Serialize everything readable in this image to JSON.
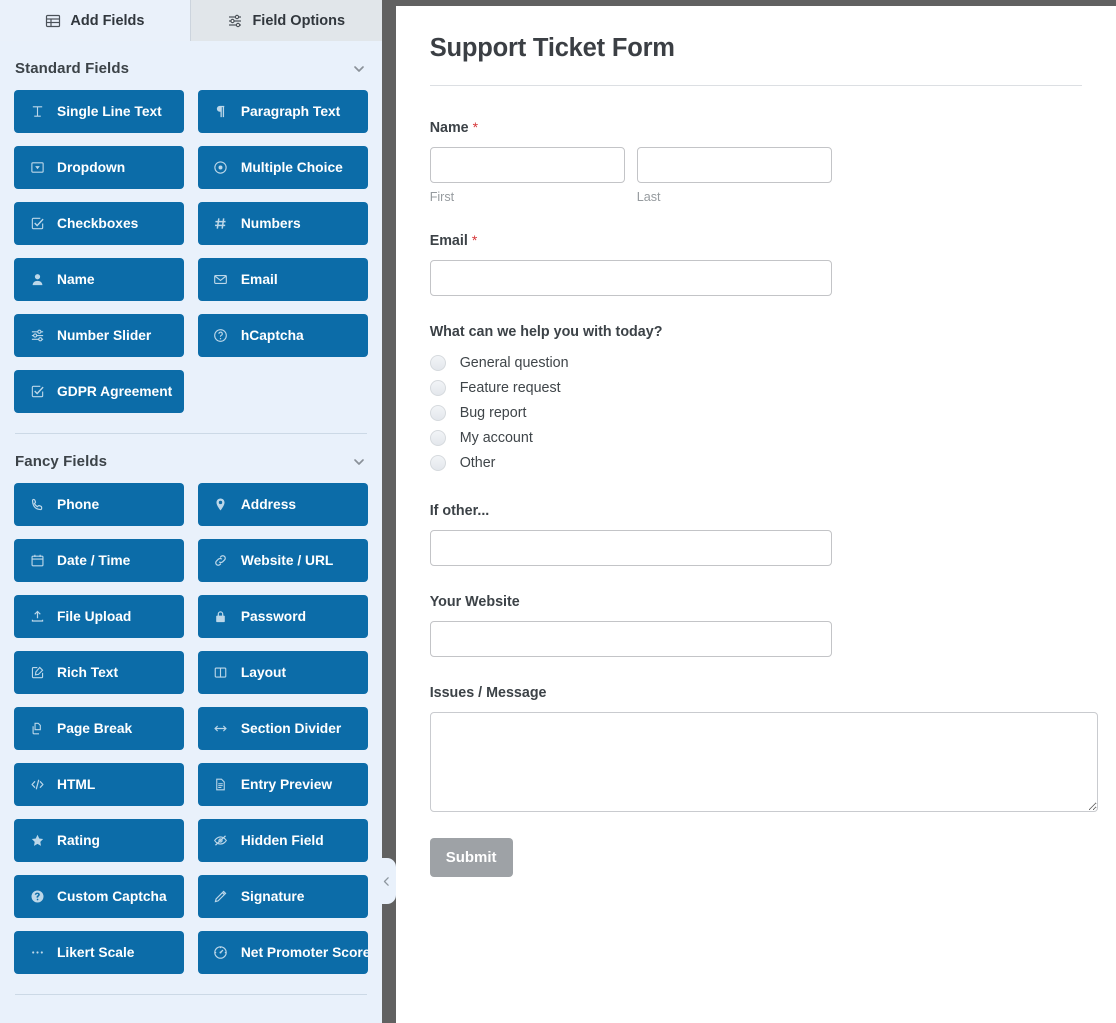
{
  "tabs": [
    {
      "label": "Add Fields",
      "icon": "table-icon",
      "active": true
    },
    {
      "label": "Field Options",
      "icon": "sliders-icon",
      "active": false
    }
  ],
  "sections": [
    {
      "title": "Standard Fields",
      "chevron": "chevron-down-icon",
      "fields": [
        {
          "label": "Single Line Text",
          "icon": "text-cursor-icon"
        },
        {
          "label": "Paragraph Text",
          "icon": "pilcrow-icon"
        },
        {
          "label": "Dropdown",
          "icon": "dropdown-icon"
        },
        {
          "label": "Multiple Choice",
          "icon": "radio-icon"
        },
        {
          "label": "Checkboxes",
          "icon": "checkbox-icon"
        },
        {
          "label": "Numbers",
          "icon": "hash-icon"
        },
        {
          "label": "Name",
          "icon": "user-icon"
        },
        {
          "label": "Email",
          "icon": "envelope-icon"
        },
        {
          "label": "Number Slider",
          "icon": "sliders-icon"
        },
        {
          "label": "hCaptcha",
          "icon": "question-circle-icon"
        },
        {
          "label": "GDPR Agreement",
          "icon": "checkbox-icon"
        }
      ]
    },
    {
      "title": "Fancy Fields",
      "chevron": "chevron-down-icon",
      "fields": [
        {
          "label": "Phone",
          "icon": "phone-icon"
        },
        {
          "label": "Address",
          "icon": "map-pin-icon"
        },
        {
          "label": "Date / Time",
          "icon": "calendar-icon"
        },
        {
          "label": "Website / URL",
          "icon": "link-icon"
        },
        {
          "label": "File Upload",
          "icon": "upload-icon"
        },
        {
          "label": "Password",
          "icon": "lock-icon"
        },
        {
          "label": "Rich Text",
          "icon": "pencil-square-icon"
        },
        {
          "label": "Layout",
          "icon": "columns-icon"
        },
        {
          "label": "Page Break",
          "icon": "pages-icon"
        },
        {
          "label": "Section Divider",
          "icon": "arrows-horizontal-icon"
        },
        {
          "label": "HTML",
          "icon": "code-icon"
        },
        {
          "label": "Entry Preview",
          "icon": "document-icon"
        },
        {
          "label": "Rating",
          "icon": "star-icon"
        },
        {
          "label": "Hidden Field",
          "icon": "eye-slash-icon"
        },
        {
          "label": "Custom Captcha",
          "icon": "question-circle-icon"
        },
        {
          "label": "Signature",
          "icon": "pen-icon"
        },
        {
          "label": "Likert Scale",
          "icon": "dots-icon"
        },
        {
          "label": "Net Promoter Score",
          "icon": "gauge-icon"
        }
      ]
    }
  ],
  "collapse_handle": {
    "icon": "chevron-left-icon"
  },
  "form": {
    "title": "Support Ticket Form",
    "name_field": {
      "label": "Name",
      "required_mark": "*",
      "first_sublabel": "First",
      "last_sublabel": "Last",
      "first_value": "",
      "last_value": ""
    },
    "email_field": {
      "label": "Email",
      "required_mark": "*",
      "value": ""
    },
    "choice_field": {
      "label": "What can we help you with today?",
      "options": [
        "General question",
        "Feature request",
        "Bug report",
        "My account",
        "Other"
      ]
    },
    "other_field": {
      "label": "If other...",
      "value": ""
    },
    "website_field": {
      "label": "Your Website",
      "value": ""
    },
    "message_field": {
      "label": "Issues / Message",
      "value": ""
    },
    "submit_label": "Submit"
  },
  "colors": {
    "field_button_blue": "#0c6ca8",
    "sidebar_background": "#e9f1fb",
    "divider_gray": "#616161",
    "required_red": "#d63638",
    "submit_gray": "#9ea2a6"
  }
}
